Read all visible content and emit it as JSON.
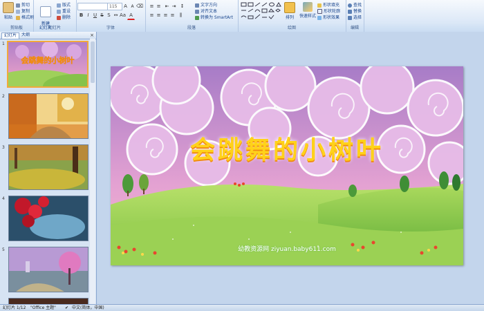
{
  "ribbon": {
    "clipboard": {
      "label": "剪贴板",
      "paste": "粘贴",
      "cut": "剪切",
      "copy": "复制",
      "format_painter": "格式刷"
    },
    "slides": {
      "label": "幻灯片",
      "new_slide": "新建\n幻灯片",
      "layout": "版式",
      "reset": "重设",
      "delete": "删除"
    },
    "font": {
      "label": "字体",
      "size": "115"
    },
    "paragraph": {
      "label": "段落",
      "text_direction": "文字方向",
      "align_text": "对齐文本",
      "smartart": "转换为 SmartArt"
    },
    "drawing": {
      "label": "绘图",
      "arrange": "排列",
      "quick_styles": "快速样式",
      "shape_fill": "形状填充",
      "shape_outline": "形状轮廓",
      "shape_effects": "形状效果"
    },
    "editing": {
      "label": "编辑",
      "find": "查找",
      "replace": "替换",
      "select": "选择"
    }
  },
  "panel": {
    "tab_slides": "幻灯片",
    "tab_outline": "大纲",
    "close": "×",
    "thumbs": [
      {
        "num": "1"
      },
      {
        "num": "2"
      },
      {
        "num": "3"
      },
      {
        "num": "4"
      },
      {
        "num": "5"
      }
    ]
  },
  "slide": {
    "title": "会跳舞的小树叶",
    "watermark": "幼教资源网 ziyuan.baby611.com"
  },
  "statusbar": {
    "slide_count": "幻灯片 1/12",
    "theme": "\"Office 主题\"",
    "language": "中文(简体，中国)"
  },
  "colors": {
    "accent": "#f2a93b",
    "title": "#ffd21a",
    "ribbon": "#dce8f7"
  }
}
